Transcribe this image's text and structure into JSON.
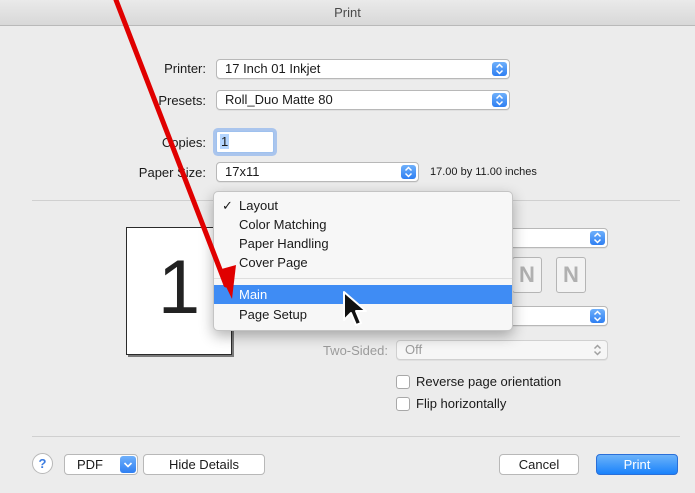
{
  "window": {
    "title": "Print"
  },
  "form": {
    "printer_label": "Printer:",
    "printer_value": "17 Inch 01 Inkjet",
    "presets_label": "Presets:",
    "presets_value": "Roll_Duo Matte 80",
    "copies_label": "Copies:",
    "copies_value": "1",
    "paper_size_label": "Paper Size:",
    "paper_size_value": "17x11",
    "paper_size_desc": "17.00 by 11.00 inches"
  },
  "preview": {
    "page_number": "1"
  },
  "section_menu": {
    "items": [
      {
        "label": "Layout",
        "checked": true
      },
      {
        "label": "Color Matching"
      },
      {
        "label": "Paper Handling"
      },
      {
        "label": "Cover Page"
      },
      {
        "label": "Main",
        "highlighted": true
      },
      {
        "label": "Page Setup"
      }
    ]
  },
  "layout": {
    "layout_direction_icons": [
      "N",
      "N"
    ],
    "two_sided_label": "Two-Sided:",
    "two_sided_value": "Off",
    "reverse_orientation_label": "Reverse page orientation",
    "flip_horizontally_label": "Flip horizontally"
  },
  "footer": {
    "help_label": "?",
    "pdf_label": "PDF",
    "hide_details_label": "Hide Details",
    "cancel_label": "Cancel",
    "print_label": "Print"
  },
  "colors": {
    "accent": "#3f8cf4",
    "annotation_arrow": "#e00000"
  }
}
